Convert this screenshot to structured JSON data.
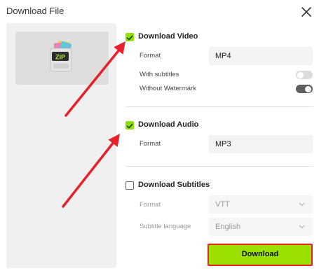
{
  "dialog": {
    "title": "Download File"
  },
  "video": {
    "heading": "Download Video",
    "checked": true,
    "format_label": "Format",
    "format_value": "MP4",
    "subtitles_label": "With subtitles",
    "subtitles_on": false,
    "watermark_label": "Without Watermark",
    "watermark_on": true
  },
  "audio": {
    "heading": "Download Audio",
    "checked": true,
    "format_label": "Format",
    "format_value": "MP3"
  },
  "subtitles": {
    "heading": "Download Subtitles",
    "checked": false,
    "format_label": "Format",
    "format_value": "VTT",
    "language_label": "Subtitle language",
    "language_value": "English"
  },
  "actions": {
    "download_label": "Download"
  },
  "thumbnail": {
    "badge": "ZIP"
  },
  "colors": {
    "accent_green": "#8ee000",
    "annotation_red": "#e8202a"
  },
  "icons": {
    "close": "close-icon",
    "check": "check-icon",
    "chevron": "chevron-down-icon",
    "zip": "zip-archive-icon"
  }
}
